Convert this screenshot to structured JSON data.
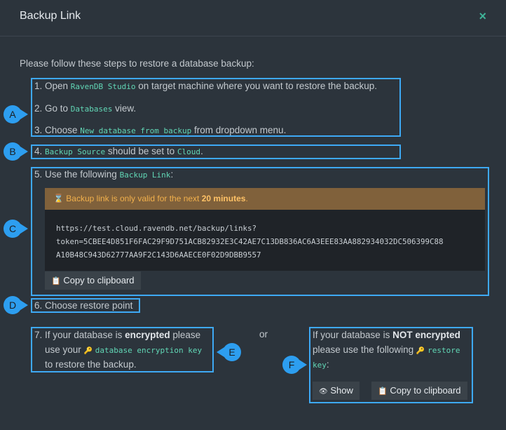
{
  "dialog": {
    "title": "Backup Link",
    "close_symbol": "×",
    "intro": "Please follow these steps to restore a database backup:"
  },
  "steps": {
    "s1_a": "1. Open ",
    "s1_code": "RavenDB Studio",
    "s1_b": " on target machine where you want to restore the backup.",
    "s2_a": "2. Go to ",
    "s2_code": "Databases",
    "s2_b": " view.",
    "s3_a": "3. Choose ",
    "s3_code": "New database from backup",
    "s3_b": " from dropdown menu.",
    "s4_a": "4. ",
    "s4_code1": "Backup Source",
    "s4_b": " should be set to ",
    "s4_code2": "Cloud",
    "s4_c": ".",
    "s5_a": "5. Use the following ",
    "s5_code": "Backup Link",
    "s5_b": ":",
    "s6": "6. Choose restore point",
    "s7_a": "7. If your database is ",
    "s7_bold": "encrypted",
    "s7_b": " please",
    "s7_c": "use your ",
    "s7_code": "database encryption key",
    "s7_d": "to restore the backup.",
    "or": "or",
    "nf_a": "If your database is ",
    "nf_bold": "NOT encrypted",
    "nf_b": "please use the following ",
    "nf_code1": "restore",
    "nf_code2": "key",
    "nf_c": ":"
  },
  "warning": {
    "icon": "⌛",
    "text_a": "Backup link is only valid for the next ",
    "text_bold": "20 minutes",
    "text_b": "."
  },
  "link": {
    "line1": "https://test.cloud.ravendb.net/backup/links?",
    "line2": "token=5CBEE4D851F6FAC29F9D751ACB82932E3C42AE7C13DB836AC6A3EEE83AA882934032DC506399C88",
    "line3": "A10B48C943D62777AA9F2C143D6AAECE0F02D9DBB9557"
  },
  "buttons": {
    "copy1": "Copy to clipboard",
    "show": "Show",
    "copy2": "Copy to clipboard",
    "clipboard_icon": "📋",
    "eye_icon": "👁"
  },
  "markers": {
    "a": "A",
    "b": "B",
    "c": "C",
    "d": "D",
    "e": "E",
    "f": "F"
  },
  "icons": {
    "key": "🔑"
  },
  "colors": {
    "accent": "#3ea9f5",
    "code": "#61d6b5",
    "warning_bg": "#80613b",
    "warning_text": "#f1b04c",
    "close": "#3fb398"
  }
}
